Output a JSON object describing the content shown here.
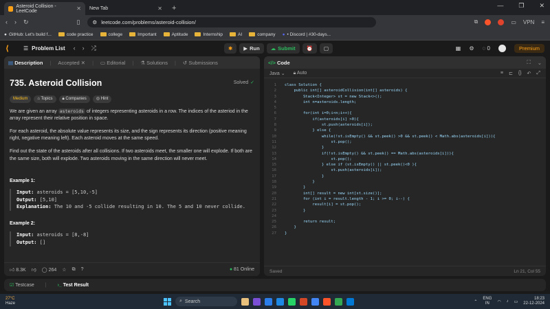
{
  "browser": {
    "tabs": [
      {
        "title": "Asteroid Collision - LeetCode",
        "active": true
      },
      {
        "title": "New Tab",
        "active": false
      }
    ],
    "url": "leetcode.com/problems/asteroid-collision/",
    "vpn_label": "VPN",
    "bookmarks": [
      "GitHub: Let's build f...",
      "code practice",
      "college",
      "Important",
      "Aptitude",
      "Internship",
      "AI",
      "company",
      "• Discord | #30-days..."
    ]
  },
  "lc": {
    "problem_list": "Problem List",
    "run": "Run",
    "submit": "Submit",
    "streak": "0",
    "premium": "Premium"
  },
  "left": {
    "tabs": [
      "Description",
      "Accepted",
      "Editorial",
      "Solutions",
      "Submissions"
    ],
    "title": "735. Asteroid Collision",
    "solved": "Solved",
    "tags": [
      "Medium",
      "Topics",
      "Companies",
      "Hint"
    ],
    "p1_a": "We are given an array ",
    "p1_code": "asteroids",
    "p1_b": " of integers representing asteroids in a row. The indices of the asteriod in the array represent their relative position in space.",
    "p2": "For each asteroid, the absolute value represents its size, and the sign represents its direction (positive meaning right, negative meaning left). Each asteroid moves at the same speed.",
    "p3": "Find out the state of the asteroids after all collisions. If two asteroids meet, the smaller one will explode. If both are the same size, both will explode. Two asteroids moving in the same direction will never meet.",
    "ex1": {
      "title": "Example 1:",
      "input_label": "Input:",
      "input": "asteroids = [5,10,-5]",
      "output_label": "Output:",
      "output": "[5,10]",
      "expl_label": "Explanation:",
      "expl": "The 10 and -5 collide resulting in 10. The 5 and 10 never collide."
    },
    "ex2": {
      "title": "Example 2:",
      "input_label": "Input:",
      "input": "asteroids = [8,-8]",
      "output_label": "Output:",
      "output": "[]"
    },
    "likes": "8.3K",
    "comments": "264",
    "online": "81 Online"
  },
  "editor": {
    "title": "Code",
    "language": "Java",
    "mode": "Auto",
    "saved": "Saved",
    "cursor": "Ln 21, Col 55",
    "lines": [
      "class Solution {",
      "    public int[] asteroidCollision(int[] asteroids) {",
      "        Stack<Integer> st = new Stack<>();",
      "        int n=asteroids.length;",
      "",
      "        for(int i=0;i<n;i++){",
      "            if(asteroids[i] >0){",
      "                st.push(asteroids[i]);",
      "            } else {",
      "                while(!st.isEmpty() && st.peek() >0 && st.peek() < Math.abs(asteroids[i])){",
      "                    st.pop();",
      "                }",
      "                if(!st.isEmpty() && st.peek() == Math.abs(asteroids[i])){",
      "                    st.pop();",
      "                } else if (st.isEmpty() || st.peek()<0 ){",
      "                    st.push(asteroids[i]);",
      "                }",
      "            }",
      "        }",
      "        int[] result = new int[st.size()];",
      "        for (int i = result.length - 1; i >= 0; i--) {",
      "            result[i] = st.pop();",
      "        }",
      "",
      "        return result;",
      "    }",
      "}"
    ]
  },
  "bottom": {
    "testcase": "Testcase",
    "test_result": "Test Result"
  },
  "taskbar": {
    "weather_temp": "27°C",
    "weather_desc": "Haze",
    "search": "Search",
    "lang": "ENG",
    "region": "IN",
    "time": "18:23",
    "date": "22-12-2024"
  }
}
